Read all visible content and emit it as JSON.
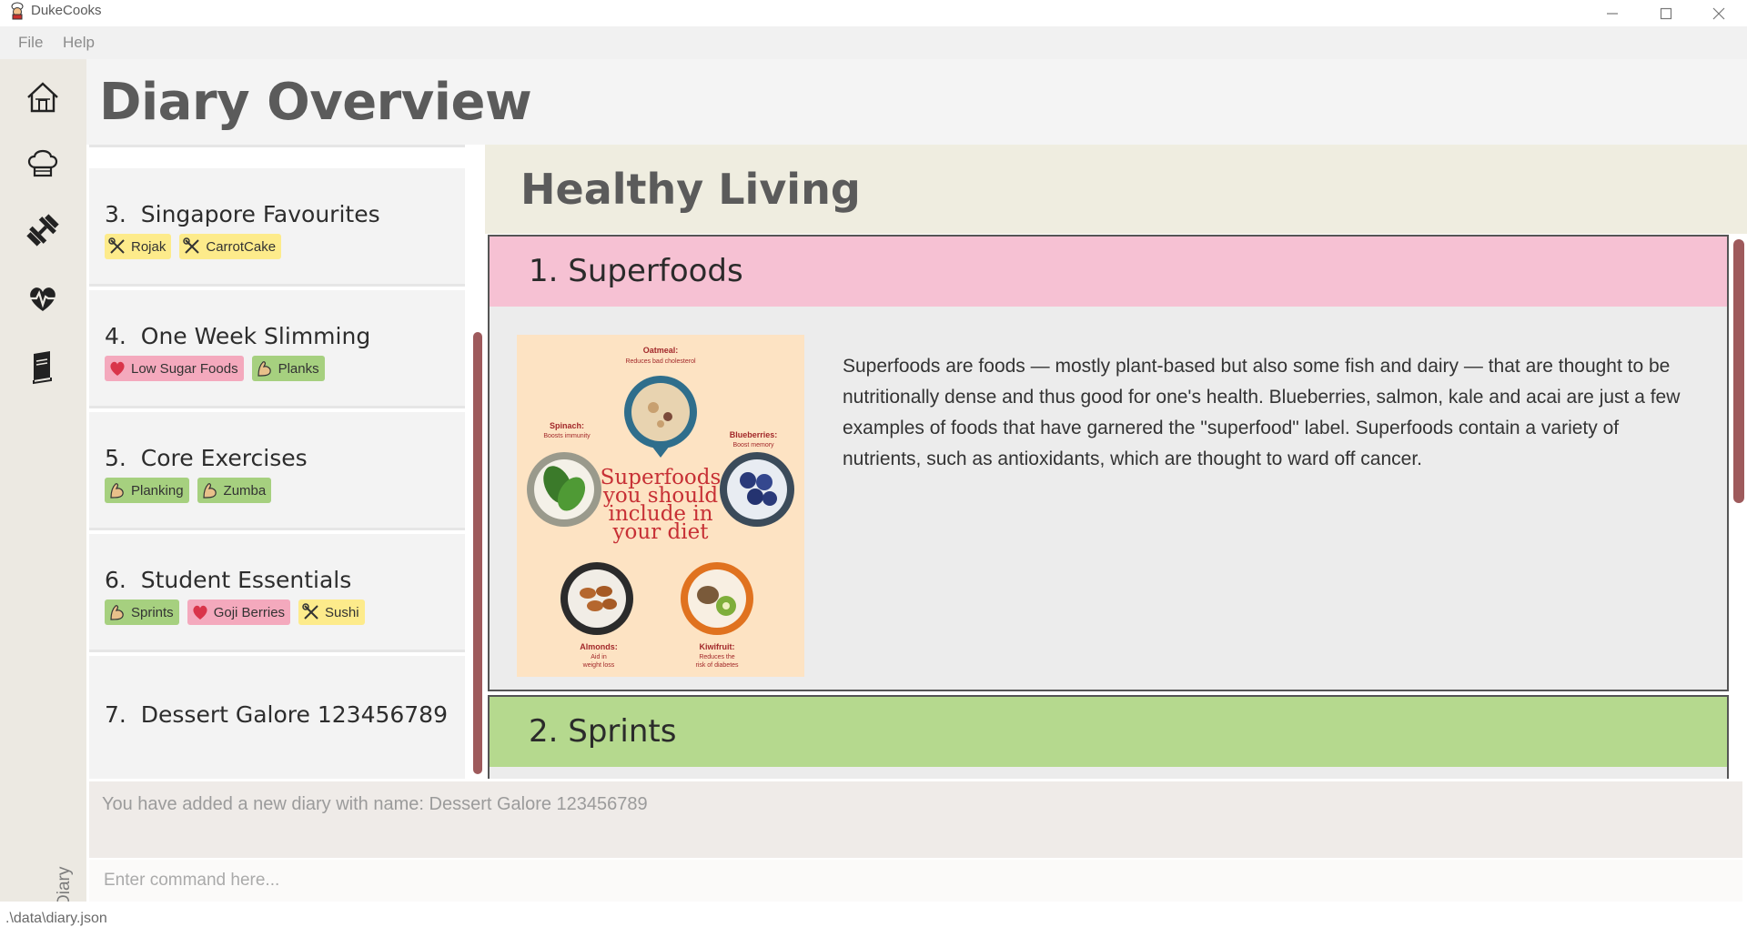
{
  "window": {
    "title": "DukeCooks",
    "controls": [
      "minimize",
      "maximize",
      "close"
    ]
  },
  "menu": {
    "items": [
      "File",
      "Help"
    ]
  },
  "sidebar": {
    "icons": [
      "home-icon",
      "chef-hat-icon",
      "dumbbell-icon",
      "heartbeat-icon",
      "diary-book-icon"
    ],
    "active_label": "Diary"
  },
  "header": {
    "title": "Diary Overview"
  },
  "diaries": [
    {
      "index": "3.",
      "name": "Singapore Favourites",
      "tags": [
        {
          "label": "Rojak",
          "type": "meal",
          "icon": "utensils-icon"
        },
        {
          "label": "CarrotCake",
          "type": "meal",
          "icon": "utensils-icon"
        }
      ]
    },
    {
      "index": "4.",
      "name": "One Week Slimming",
      "tags": [
        {
          "label": "Low Sugar Foods",
          "type": "health",
          "icon": "heart-icon"
        },
        {
          "label": "Planks",
          "type": "exercise",
          "icon": "bicep-icon"
        }
      ]
    },
    {
      "index": "5.",
      "name": "Core Exercises",
      "tags": [
        {
          "label": "Planking",
          "type": "exercise",
          "icon": "bicep-icon"
        },
        {
          "label": "Zumba",
          "type": "exercise",
          "icon": "bicep-icon"
        }
      ]
    },
    {
      "index": "6.",
      "name": "Student Essentials",
      "tags": [
        {
          "label": "Sprints",
          "type": "exercise",
          "icon": "bicep-icon"
        },
        {
          "label": "Goji Berries",
          "type": "health",
          "icon": "heart-icon"
        },
        {
          "label": "Sushi",
          "type": "meal",
          "icon": "utensils-icon"
        }
      ]
    },
    {
      "index": "7.",
      "name": "Dessert Galore 123456789",
      "tags": []
    }
  ],
  "detail": {
    "title": "Healthy Living",
    "pages": [
      {
        "heading": "1. Superfoods",
        "color": "#f6c1d3",
        "description": "Superfoods are foods — mostly plant-based but also some fish and dairy — that are thought to be nutritionally dense and thus good for one's health. Blueberries, salmon, kale and acai are just a few examples of foods that have garnered the \"superfood\" label. Superfoods contain a variety of nutrients, such as antioxidants, which are thought to ward off cancer.",
        "image": {
          "headline": "Superfoods you should include in your diet",
          "items": [
            {
              "name": "Oatmeal:",
              "note": "Reduces bad cholesterol"
            },
            {
              "name": "Spinach:",
              "note": "Boosts immunity"
            },
            {
              "name": "Blueberries:",
              "note": "Boost memory"
            },
            {
              "name": "Almonds:",
              "note": "Aid in weight loss"
            },
            {
              "name": "Kiwifruit:",
              "note": "Reduces the risk of diabetes"
            }
          ]
        }
      },
      {
        "heading": "2. Sprints",
        "color": "#b5d98e"
      }
    ]
  },
  "result": {
    "message": "You have added a new diary with name: Dessert Galore 123456789"
  },
  "command": {
    "placeholder": "Enter command here...",
    "value": ""
  },
  "status": {
    "path": ".\\data\\diary.json"
  },
  "colors": {
    "meal_tag": "#fdeb8b",
    "exercise_tag": "#a6d07f",
    "health_tag": "#f4a9bd",
    "scrollbar": "#9e5a5c"
  }
}
